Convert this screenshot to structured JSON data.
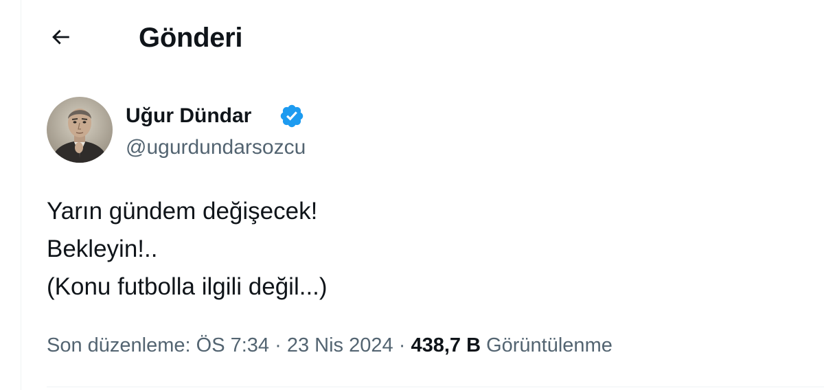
{
  "header": {
    "back_icon": "arrow-left-icon",
    "title": "Gönderi"
  },
  "author": {
    "name": "Uğur Dündar",
    "handle": "@ugurdundarsozcu",
    "verified_icon": "verified-badge-icon",
    "verified_color": "#1d9bf0"
  },
  "tweet": {
    "lines": [
      "Yarın gündem değişecek!",
      "Bekleyin!..",
      "(Konu futbolla ilgili değil...)"
    ]
  },
  "meta": {
    "edited_label": "Son düzenleme:",
    "time": "ÖS 7:34",
    "separator": "·",
    "date": "23 Nis 2024",
    "views_count": "438,7 B",
    "views_label": "Görüntülenme"
  },
  "colors": {
    "text_primary": "#0f1419",
    "text_secondary": "#536471",
    "border": "#eff3f4"
  }
}
